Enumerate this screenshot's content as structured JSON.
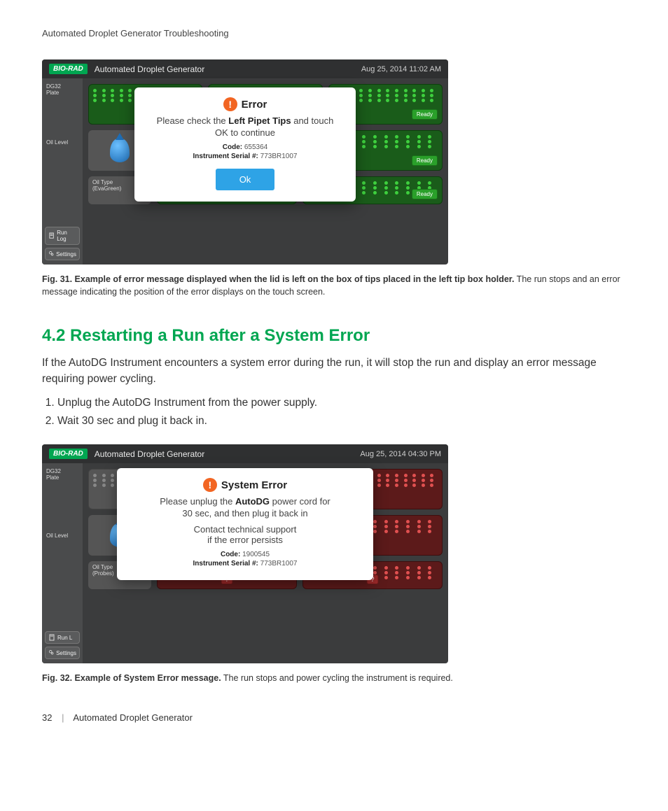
{
  "header": "Automated Droplet Generator Troubleshooting",
  "fig31": {
    "top": {
      "brand": "BIO-RAD",
      "title": "Automated Droplet Generator",
      "time": "Aug 25, 2014 11:02 AM"
    },
    "side": {
      "plate_label": "DG32\nPlate",
      "oil_label": "Oil Level",
      "runlog": "Run Log",
      "settings": "Settings",
      "oiltype_label": "Oil Type",
      "oiltype_value": "(EvaGreen)"
    },
    "badges": {
      "ready": "Ready"
    },
    "dialog": {
      "title": "Error",
      "line1a": "Please check the ",
      "line1b": "Left Pipet Tips",
      "line1c": " and touch",
      "line2": "OK to continue",
      "code_label": "Code:",
      "code": "655364",
      "serial_label": "Instrument Serial #:",
      "serial": "773BR1007",
      "ok": "Ok"
    },
    "caption_bold": "Fig. 31. Example of error message displayed when the lid is left on the box of tips placed in the left tip box holder.",
    "caption_rest": " The run stops and an error message indicating the position of the error displays on the touch screen."
  },
  "section": {
    "title": "4.2 Restarting a Run after a System Error",
    "para": "If the AutoDG Instrument encounters a system error during the run, it will stop the run and display an error message requiring power cycling.",
    "steps": [
      "Unplug the AutoDG Instrument from the power supply.",
      "Wait 30 sec and plug it back in."
    ]
  },
  "fig32": {
    "top": {
      "brand": "BIO-RAD",
      "title": "Automated Droplet Generator",
      "time": "Aug 25, 2014 04:30 PM"
    },
    "side": {
      "plate_label": "DG32\nPlate",
      "oil_label": "Oil Level",
      "runlog": "Run L",
      "settings": "Settings",
      "oiltype_label": "Oil Type",
      "oiltype_value": "(Probes)"
    },
    "badges": {
      "q": "?"
    },
    "dialog": {
      "title": "System Error",
      "line1a": "Please unplug the ",
      "line1b": "AutoDG",
      "line1c": " power cord for",
      "line2": "30 sec, and then plug it back in",
      "line3": "Contact technical support",
      "line4": "if the error persists",
      "code_label": "Code:",
      "code": "1900545",
      "serial_label": "Instrument Serial #:",
      "serial": "773BR1007"
    },
    "caption_bold": "Fig. 32. Example of System Error message.",
    "caption_rest": " The run stops and power cycling the instrument is required."
  },
  "footer": {
    "page": "32",
    "title": "Automated Droplet Generator"
  }
}
